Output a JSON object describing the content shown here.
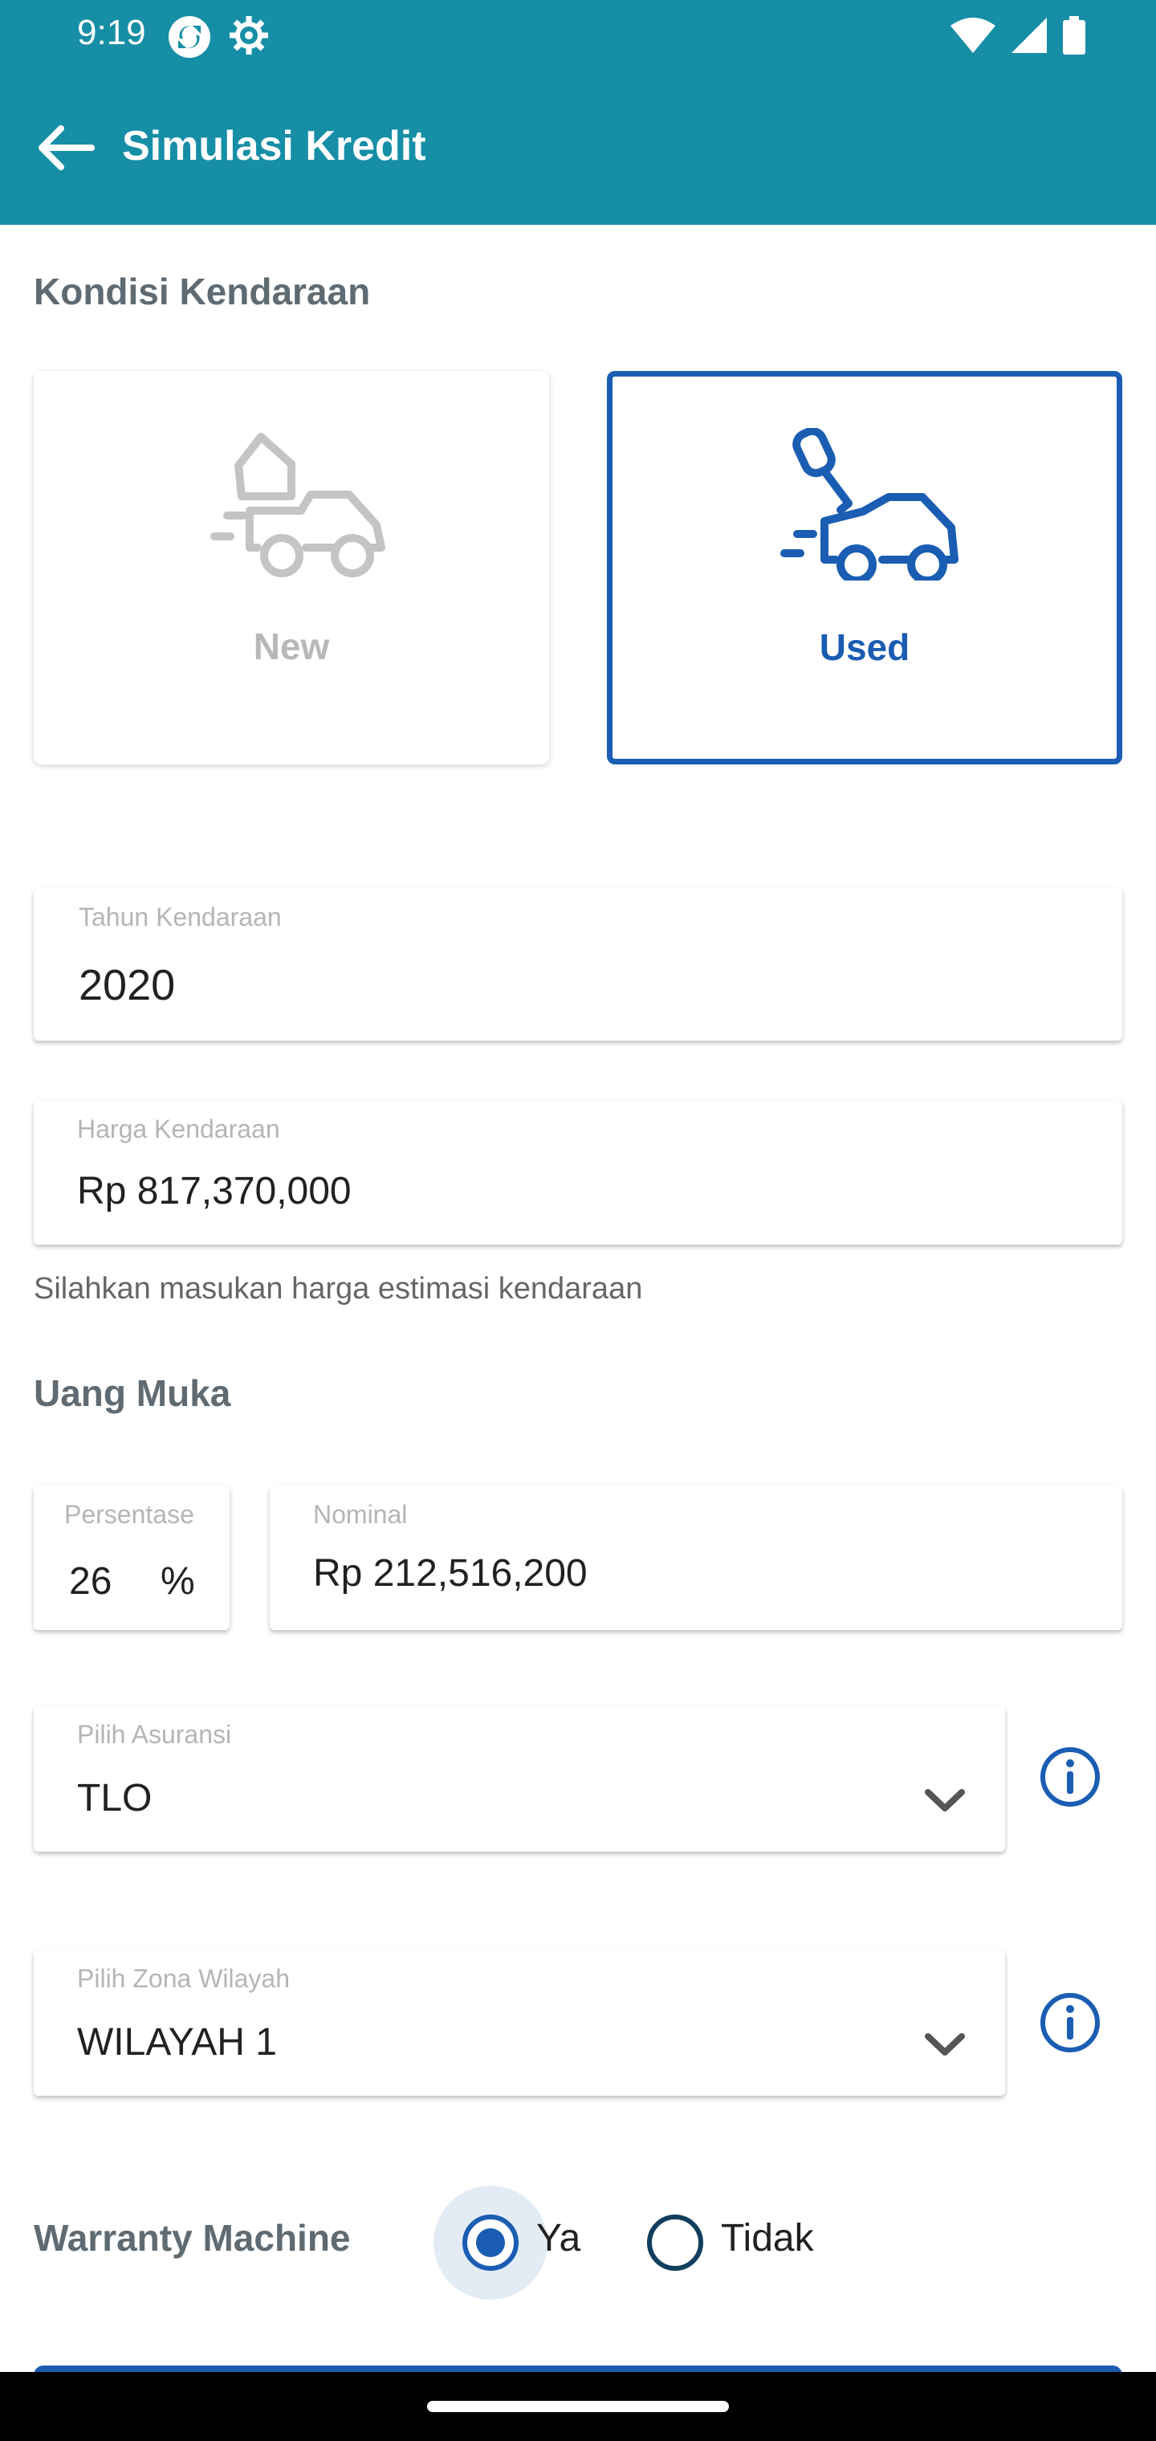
{
  "status_bar": {
    "time": "9:19",
    "left_icons": [
      "sync-icon",
      "settings-icon"
    ],
    "right_icons": [
      "wifi-icon",
      "signal-icon",
      "battery-icon"
    ]
  },
  "app_bar": {
    "title": "Simulasi Kredit",
    "back_icon": "arrow-left-icon",
    "background": "#168ea6"
  },
  "vehicle_condition": {
    "section_title": "Kondisi Kendaraan",
    "options": [
      {
        "label": "New",
        "icon": "new-car-tag-icon",
        "selected": false
      },
      {
        "label": "Used",
        "icon": "used-car-key-icon",
        "selected": true
      }
    ],
    "selected_color": "#1a5db3"
  },
  "vehicle_year": {
    "label": "Tahun Kendaraan",
    "value": "2020"
  },
  "vehicle_price": {
    "label": "Harga Kendaraan",
    "value": "Rp 817,370,000",
    "helper": "Silahkan masukan harga estimasi kendaraan"
  },
  "down_payment": {
    "section_title": "Uang Muka",
    "percentage": {
      "label": "Persentase",
      "value": "26",
      "unit": "%"
    },
    "nominal": {
      "label": "Nominal",
      "value": "Rp 212,516,200"
    }
  },
  "insurance": {
    "label": "Pilih Asuransi",
    "value": "TLO",
    "icon": "chevron-down-icon",
    "info_icon": "info-icon"
  },
  "zone": {
    "label": "Pilih Zona Wilayah",
    "value": "WILAYAH 1",
    "icon": "chevron-down-icon",
    "info_icon": "info-icon"
  },
  "warranty": {
    "label": "Warranty Machine",
    "options": [
      {
        "label": "Ya",
        "selected": true
      },
      {
        "label": "Tidak",
        "selected": false
      }
    ]
  }
}
